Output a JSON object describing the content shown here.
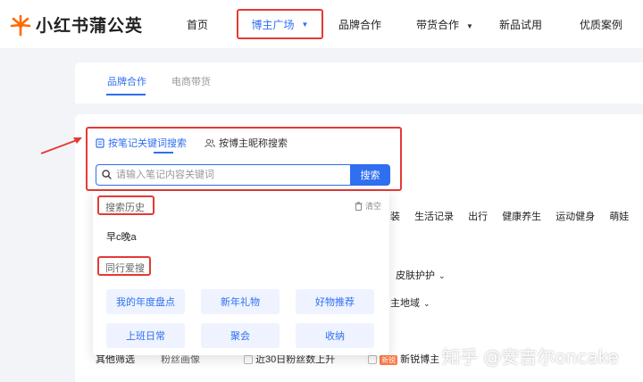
{
  "brand": {
    "name": "小红书蒲公英",
    "logo_icon": "dandelion-icon",
    "accent": "#ff6a00"
  },
  "nav": {
    "items": [
      {
        "label": "首页"
      },
      {
        "label": "博主广场",
        "active": true,
        "has_dropdown": true
      },
      {
        "label": "品牌合作"
      },
      {
        "label": "带货合作",
        "has_dropdown": true
      },
      {
        "label": "新品试用"
      },
      {
        "label": "优质案例"
      }
    ]
  },
  "sub_tabs": [
    {
      "label": "品牌合作",
      "active": true
    },
    {
      "label": "电商带货",
      "active": false
    }
  ],
  "search": {
    "modes": [
      {
        "label": "按笔记关键词搜索",
        "icon": "note-icon",
        "active": true
      },
      {
        "label": "按博主昵称搜索",
        "icon": "users-icon",
        "active": false
      }
    ],
    "placeholder": "请输入笔记内容关键词",
    "button_label": "搜索"
  },
  "dropdown": {
    "history_label": "搜索历史",
    "clear_label": "清空",
    "history_items": [
      "早c晚a"
    ],
    "peer_label": "同行爱搜",
    "peer_chips": [
      "我的年度盘点",
      "新年礼物",
      "好物推荐",
      "上班日常",
      "聚会",
      "收纳"
    ]
  },
  "background": {
    "category_row": [
      "装",
      "生活记录",
      "出行",
      "健康养生",
      "运动健身",
      "萌娃"
    ],
    "filter_skin": "皮肤护护",
    "filter_region": "主地域",
    "bottom_left": "其他筛选",
    "bottom_mid": "粉丝画像",
    "bottom_check": "近30日粉丝数上升",
    "bottom_badge": "新锐",
    "bottom_new": "新锐博主"
  },
  "watermark": "知乎 @安吉尔oncake",
  "colors": {
    "primary": "#2f6ff0",
    "highlight": "#e53935",
    "chip_bg": "#eef3ff"
  }
}
